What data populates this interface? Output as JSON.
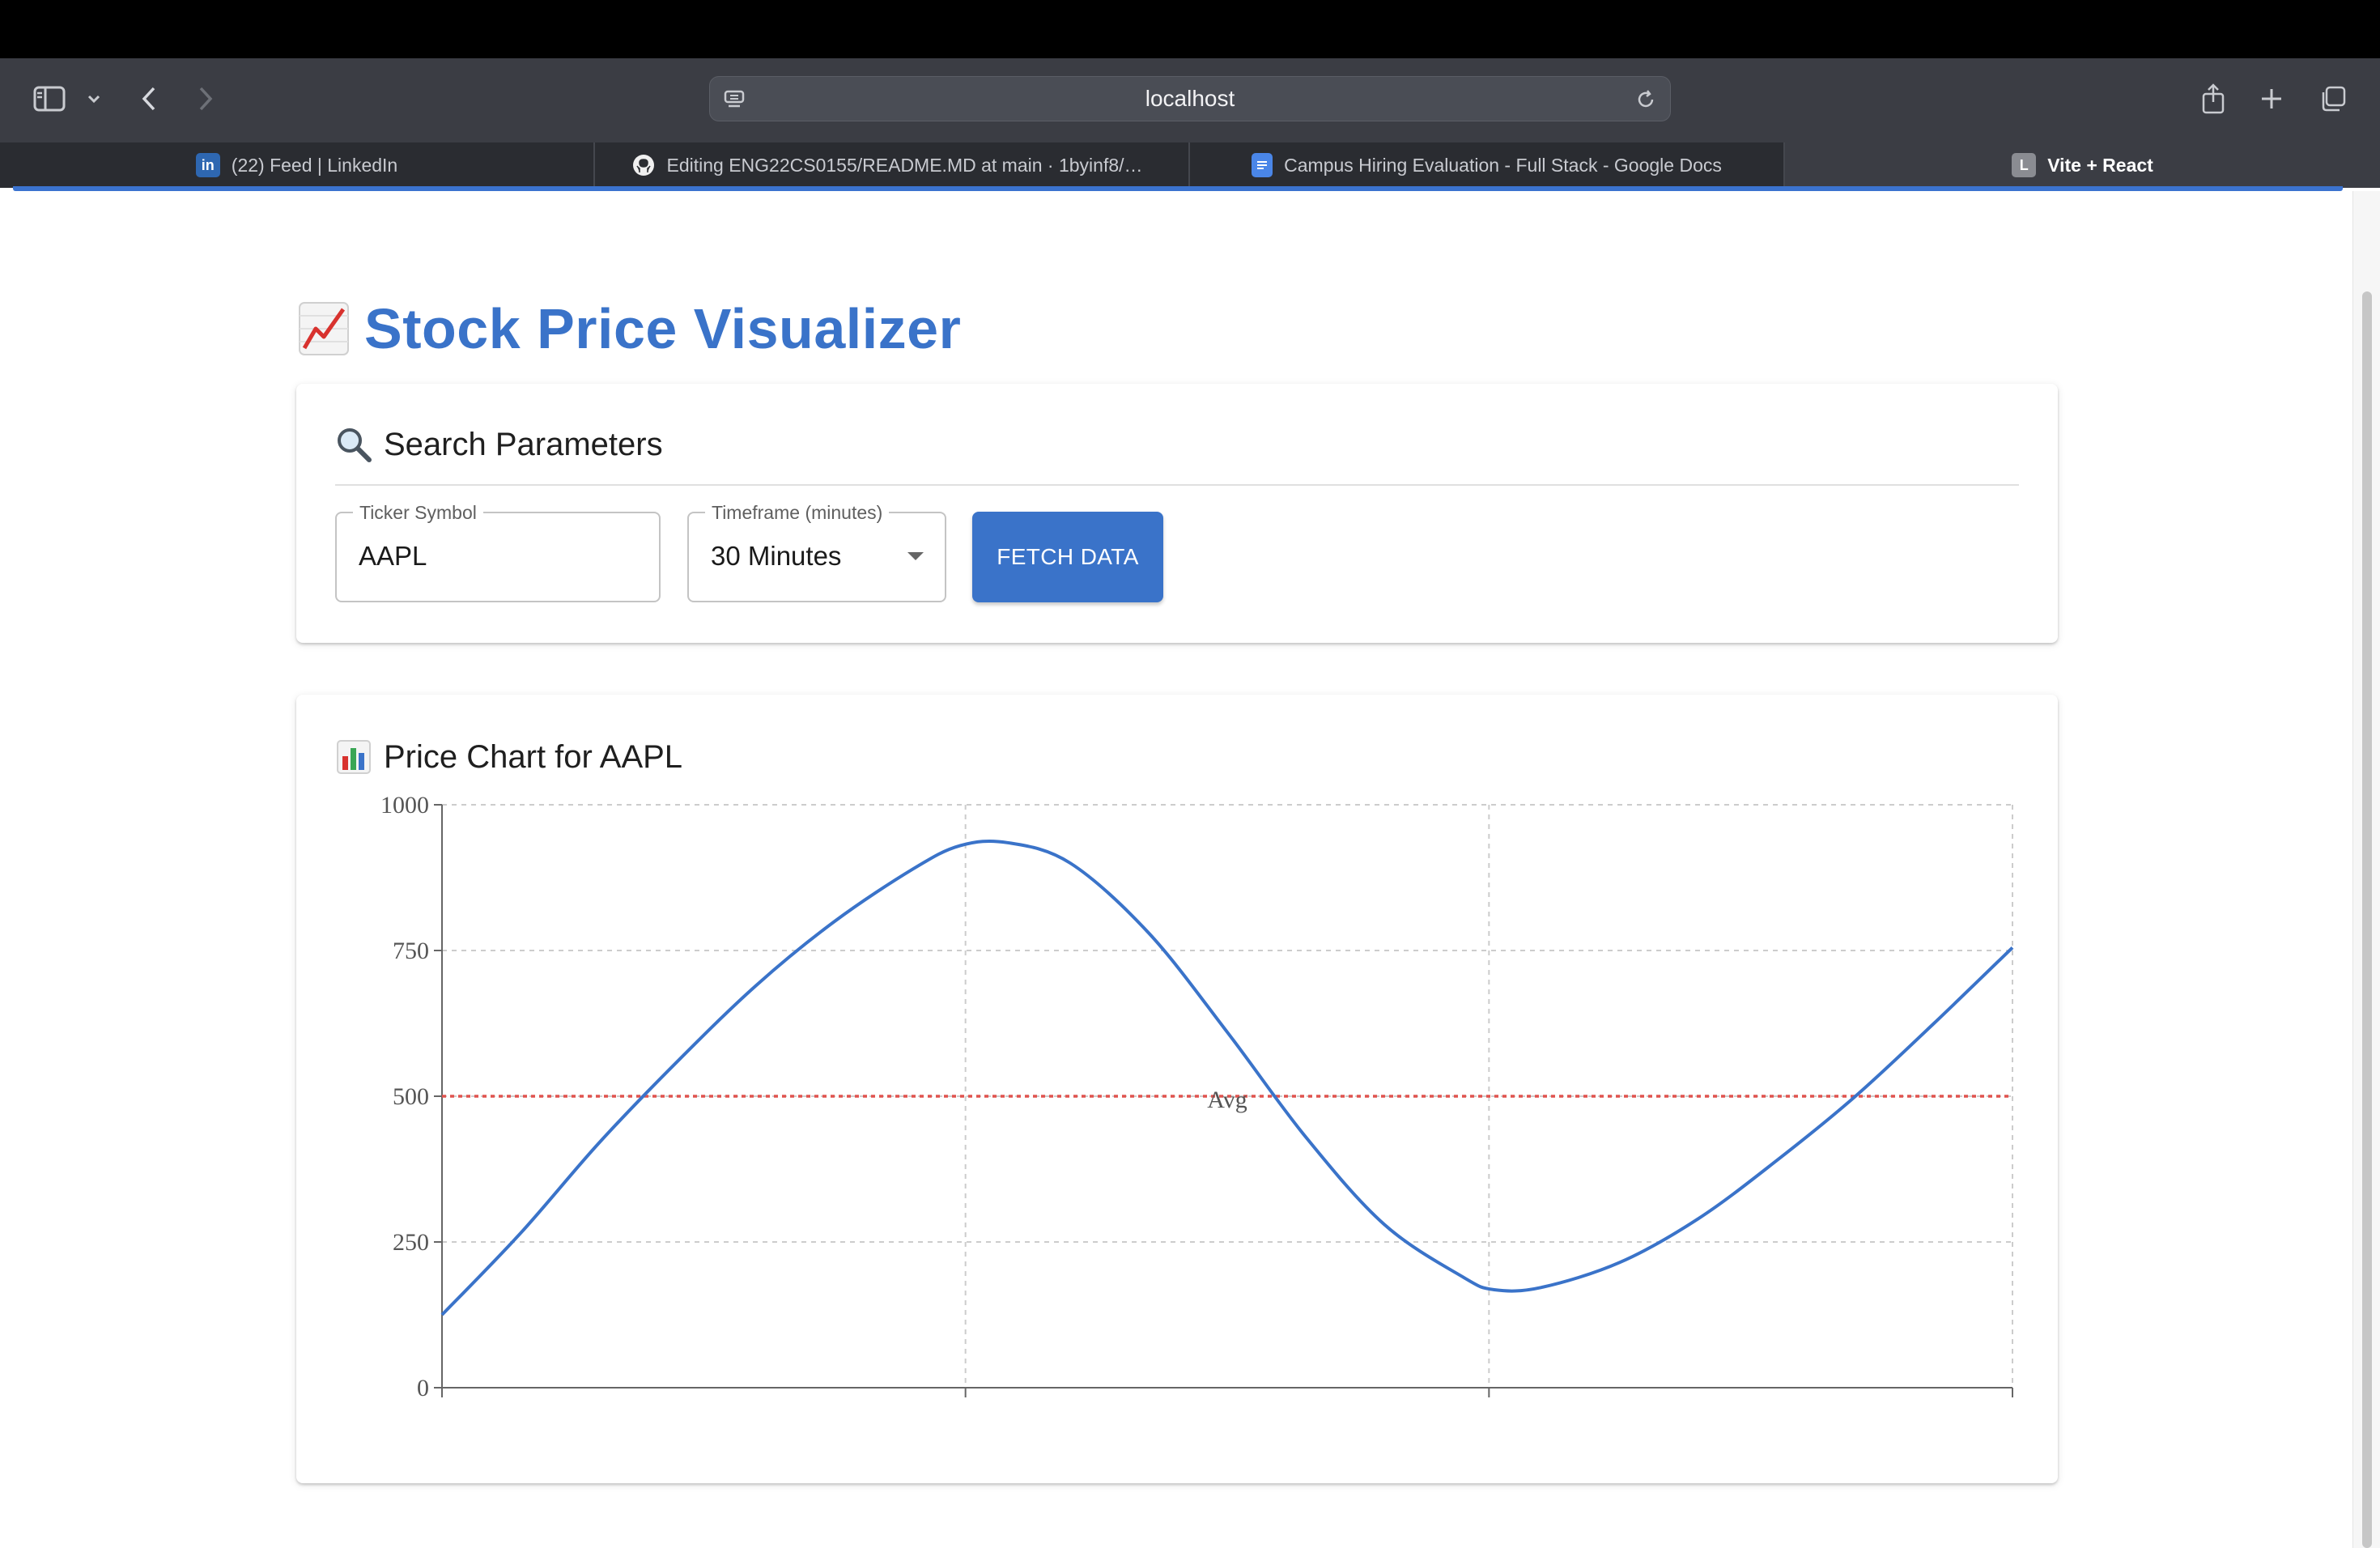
{
  "browser": {
    "address": "localhost",
    "tabs": [
      {
        "label": "(22) Feed | LinkedIn",
        "icon": "linkedin-icon",
        "active": false
      },
      {
        "label": "Editing ENG22CS0155/README.MD at main · 1byinf8/ENG2…",
        "icon": "github-icon",
        "active": false
      },
      {
        "label": "Campus Hiring Evaluation - Full Stack - Google Docs",
        "icon": "google-docs-icon",
        "active": false
      },
      {
        "label": "Vite + React",
        "icon": "vite-letter-icon",
        "icon_letter": "L",
        "active": true
      }
    ]
  },
  "page": {
    "title": "Stock Price Visualizer",
    "title_icon": "chart-increasing-icon",
    "accent_color": "#3a73c9"
  },
  "search": {
    "heading": "Search Parameters",
    "heading_icon": "magnifier-icon",
    "ticker_label": "Ticker Symbol",
    "ticker_value": "AAPL",
    "timeframe_label": "Timeframe (minutes)",
    "timeframe_value": "30 Minutes",
    "fetch_label": "FETCH DATA"
  },
  "chart_section": {
    "heading": "Price Chart for AAPL",
    "heading_icon": "bar-chart-icon"
  },
  "chart_data": {
    "type": "line",
    "title": "",
    "xlabel": "",
    "ylabel": "",
    "x": [
      0,
      0.05,
      0.1,
      0.15,
      0.2,
      0.25,
      0.3,
      0.33,
      0.36,
      0.4,
      0.45,
      0.5,
      0.55,
      0.6,
      0.65,
      0.67,
      0.7,
      0.75,
      0.8,
      0.85,
      0.9,
      0.95,
      1.0
    ],
    "series": [
      {
        "values": [
          125,
          265,
          420,
          560,
          690,
          800,
          890,
          930,
          935,
          900,
          780,
          610,
          430,
          280,
          190,
          168,
          172,
          215,
          290,
          390,
          500,
          625,
          755
        ],
        "color": "#3a73c9"
      }
    ],
    "y_ticks": [
      "0",
      "250",
      "500",
      "750",
      "1000"
    ],
    "ylim": [
      0,
      1000
    ],
    "grid": true,
    "grid_x_divisions": 3,
    "reference_line": {
      "value": 500,
      "label": "Avg",
      "color": "#e0534e"
    }
  }
}
